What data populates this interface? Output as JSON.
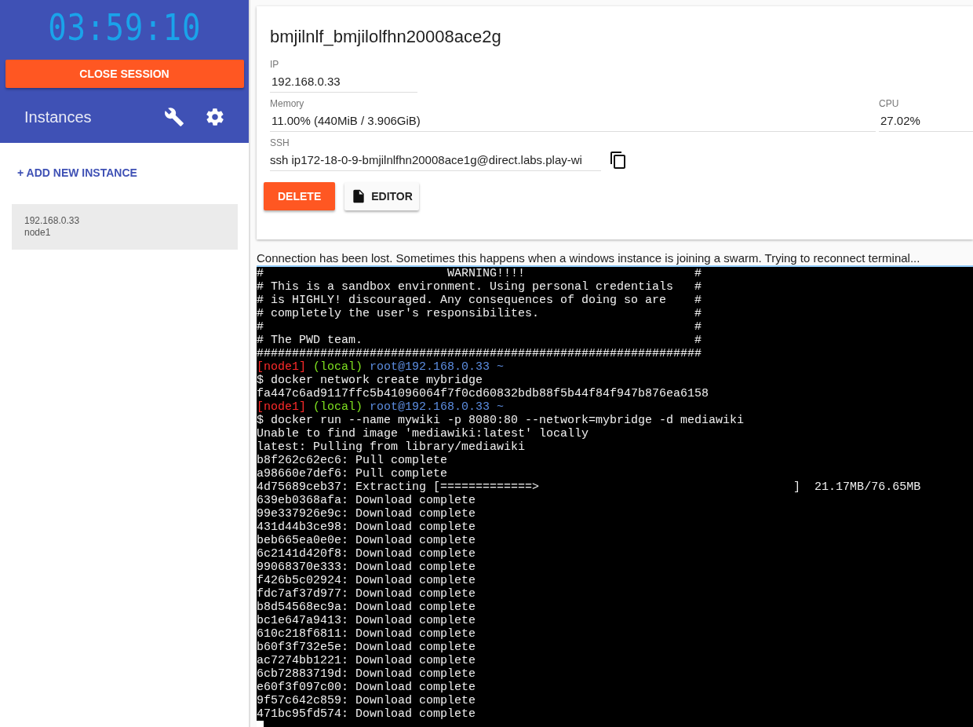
{
  "sidebar": {
    "timer": "03:59:10",
    "close_button": "CLOSE SESSION",
    "title": "Instances",
    "add_button": "+ ADD NEW INSTANCE",
    "instances": [
      {
        "ip": "192.168.0.33",
        "name": "node1",
        "selected": true
      }
    ]
  },
  "instance": {
    "title": "bmjilnlf_bmjilolfhn20008ace2g",
    "fields": [
      {
        "label": "IP",
        "value": "192.168.0.33",
        "kind": "short"
      },
      {
        "label": "Memory",
        "value": "11.00% (440MiB / 3.906GiB)",
        "kind": "wide"
      },
      {
        "label": "CPU",
        "value": "27.02%",
        "kind": "side"
      },
      {
        "label": "SSH",
        "value": "ssh ip172-18-0-9-bmjilnlfhn20008ace1g@direct.labs.play-wi",
        "kind": "copy"
      }
    ],
    "delete_button": "DELETE",
    "editor_button": "EDITOR"
  },
  "message": "Connection has been lost. Sometimes this happens when a windows instance is joining a swarm. Trying to reconnect terminal...",
  "terminal": [
    {
      "kind": "text",
      "text": "#                          WARNING!!!!                        #"
    },
    {
      "kind": "text",
      "text": "# This is a sandbox environment. Using personal credentials   #"
    },
    {
      "kind": "text",
      "text": "# is HIGHLY! discouraged. Any consequences of doing so are    #"
    },
    {
      "kind": "text",
      "text": "# completely the user's responsibilites.                      #"
    },
    {
      "kind": "text",
      "text": "#                                                             #"
    },
    {
      "kind": "text",
      "text": "# The PWD team.                                               #"
    },
    {
      "kind": "text",
      "text": "###############################################################"
    },
    {
      "kind": "prompt",
      "host": "[node1]",
      "env": "(local)",
      "user": "root@192.168.0.33 ~"
    },
    {
      "kind": "text",
      "text": "$ docker network create mybridge"
    },
    {
      "kind": "text",
      "text": "fa447c6ad9117ffc5b41096064f7f0cd60832bdb88f5b44f84f947b876ea6158"
    },
    {
      "kind": "prompt",
      "host": "[node1]",
      "env": "(local)",
      "user": "root@192.168.0.33 ~"
    },
    {
      "kind": "text",
      "text": "$ docker run --name mywiki -p 8080:80 --network=mybridge -d mediawiki"
    },
    {
      "kind": "text",
      "text": "Unable to find image 'mediawiki:latest' locally"
    },
    {
      "kind": "text",
      "text": "latest: Pulling from library/mediawiki"
    },
    {
      "kind": "text",
      "text": "b8f262c62ec6: Pull complete"
    },
    {
      "kind": "text",
      "text": "a98660e7def6: Pull complete"
    },
    {
      "kind": "text",
      "text": "4d75689ceb37: Extracting [=============>                                    ]  21.17MB/76.65MB"
    },
    {
      "kind": "text",
      "text": "639eb0368afa: Download complete"
    },
    {
      "kind": "text",
      "text": "99e337926e9c: Download complete"
    },
    {
      "kind": "text",
      "text": "431d44b3ce98: Download complete"
    },
    {
      "kind": "text",
      "text": "beb665ea0e0e: Download complete"
    },
    {
      "kind": "text",
      "text": "6c2141d420f8: Download complete"
    },
    {
      "kind": "text",
      "text": "99068370e333: Download complete"
    },
    {
      "kind": "text",
      "text": "f426b5c02924: Download complete"
    },
    {
      "kind": "text",
      "text": "fdc7af37d977: Download complete"
    },
    {
      "kind": "text",
      "text": "b8d54568ec9a: Download complete"
    },
    {
      "kind": "text",
      "text": "bc1e647a9413: Download complete"
    },
    {
      "kind": "text",
      "text": "610c218f6811: Download complete"
    },
    {
      "kind": "text",
      "text": "b60f3f732e5e: Download complete"
    },
    {
      "kind": "text",
      "text": "ac7274bb1221: Download complete"
    },
    {
      "kind": "text",
      "text": "6cb72883719d: Download complete"
    },
    {
      "kind": "text",
      "text": "e60f3f097c00: Download complete"
    },
    {
      "kind": "text",
      "text": "9f57c642c859: Download complete"
    },
    {
      "kind": "text",
      "text": "471bc95fd574: Download complete"
    }
  ]
}
